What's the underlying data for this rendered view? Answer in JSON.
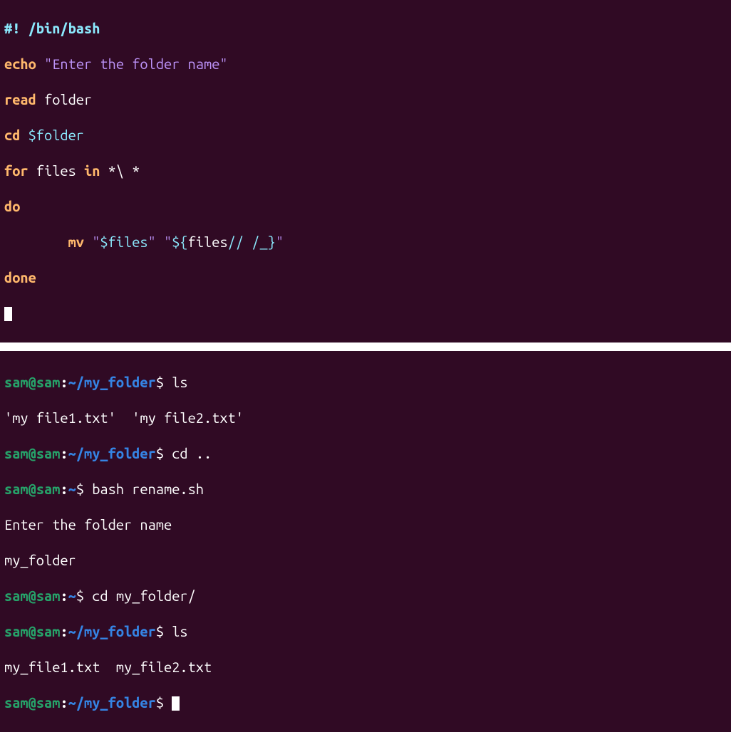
{
  "script": {
    "shebang_pre": "#! ",
    "shebang_path": "/bin/bash",
    "echo_kw": "echo",
    "echo_q1": "\"",
    "echo_str": "Enter the folder name",
    "echo_q2": "\"",
    "read_kw": "read",
    "read_arg": " folder",
    "cd_kw": "cd",
    "cd_sp": " ",
    "cd_var": "$folder",
    "for_kw": "for",
    "for_mid": " files ",
    "in_kw": "in",
    "for_glob": " *\\ *",
    "do_kw": "do",
    "mv_indent": "        ",
    "mv_kw": "mv",
    "mv_sp1": " ",
    "mv_q1": "\"",
    "mv_var1": "$files",
    "mv_q2": "\"",
    "mv_sp2": " ",
    "mv_q3": "\"",
    "mv_brace_open": "${",
    "mv_brace_var": "files",
    "mv_brace_op": "// /_",
    "mv_brace_close": "}",
    "mv_q4": "\"",
    "done_kw": "done"
  },
  "term": {
    "user": "sam",
    "at": "@",
    "host": "sam",
    "colon": ":",
    "path_home": "~",
    "path_folder": "~/my_folder",
    "dollar": "$ ",
    "cmd_ls": "ls",
    "out_ls1": "'my file1.txt'  'my file2.txt'",
    "cmd_cd_up": "cd ..",
    "cmd_bash": "bash rename.sh",
    "out_prompt_line": "Enter the folder name",
    "out_input": "my_folder",
    "cmd_cd_folder": "cd my_folder/",
    "out_ls2": "my_file1.txt  my_file2.txt"
  }
}
